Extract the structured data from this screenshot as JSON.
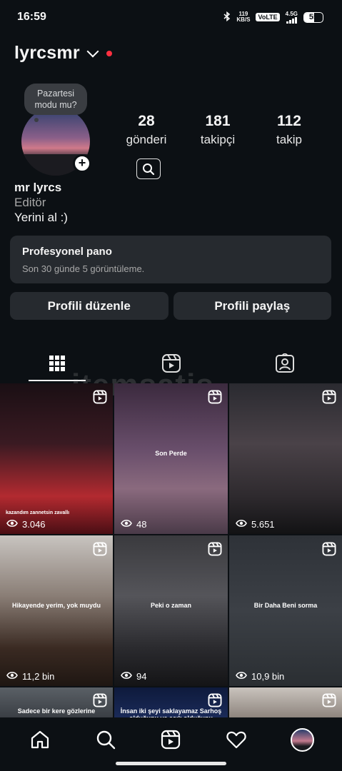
{
  "status_bar": {
    "time": "16:59",
    "net_speed_value": "119",
    "net_speed_unit": "KB/S",
    "volte": "VoLTE",
    "network": "4.5G",
    "battery": "55"
  },
  "header": {
    "username": "lyrcsmr"
  },
  "profile": {
    "note": "Pazartesi modu mu?",
    "stats": [
      {
        "value": "28",
        "label": "gönderi"
      },
      {
        "value": "181",
        "label": "takipçi"
      },
      {
        "value": "112",
        "label": "takip"
      }
    ],
    "name": "mr lyrcs",
    "category": "Editör",
    "bio": "Yerini al :)"
  },
  "pro_panel": {
    "title": "Profesyonel pano",
    "subtitle": "Son 30 günde 5 görüntüleme."
  },
  "buttons": {
    "edit": "Profili düzenle",
    "share": "Profili paylaş"
  },
  "watermark": "itemsatis",
  "grid": [
    {
      "views": "3.046",
      "caption": "kazandım zannetsin zavallı",
      "bg": "linear-gradient(180deg,#1a0f14 0%,#3a1a22 40%,#b32a30 75%,#4a0e14 100%)"
    },
    {
      "views": "48",
      "caption": "Son Perde",
      "bg": "linear-gradient(180deg,#3b2a3e 0%,#6a4f6c 45%,#8a6a7e 70%,#4a3a48 100%)"
    },
    {
      "views": "5.651",
      "caption": "",
      "bg": "linear-gradient(180deg,#2a2a30 0%,#4a4248 40%,#2e2a2e 75%,#121214 100%)"
    },
    {
      "views": "11,2 bin",
      "caption": "Hikayende yerim, yok muydu",
      "bg": "linear-gradient(180deg,#c8c4c0 0%,#8a7e76 40%,#3a2a22 75%,#1e1612 100%)"
    },
    {
      "views": "94",
      "caption": "Peki o zaman",
      "bg": "linear-gradient(180deg,#3a3a3e 0%,#55555a 40%,#2a2a2e 75%,#141416 100%)"
    },
    {
      "views": "10,9 bin",
      "caption": "Bir Daha Beni sorma",
      "bg": "linear-gradient(180deg,#2e3238 0%,#3c4046 50%,#2a2e32 100%)"
    },
    {
      "views": "",
      "caption": "Sadece bir kere gözlerine",
      "bg": "linear-gradient(180deg,#5a6066 0%,#3a3e44 100%)"
    },
    {
      "views": "",
      "caption": "İnsan iki şeyi saklayamaz Sarhoş olduğunu ve aşık olduğunu",
      "bg": "linear-gradient(180deg,#0e1a3c 0%,#1a2a58 100%)"
    },
    {
      "views": "",
      "caption": "",
      "bg": "linear-gradient(180deg,#c9c3bd 0%,#8e857e 100%)"
    }
  ]
}
